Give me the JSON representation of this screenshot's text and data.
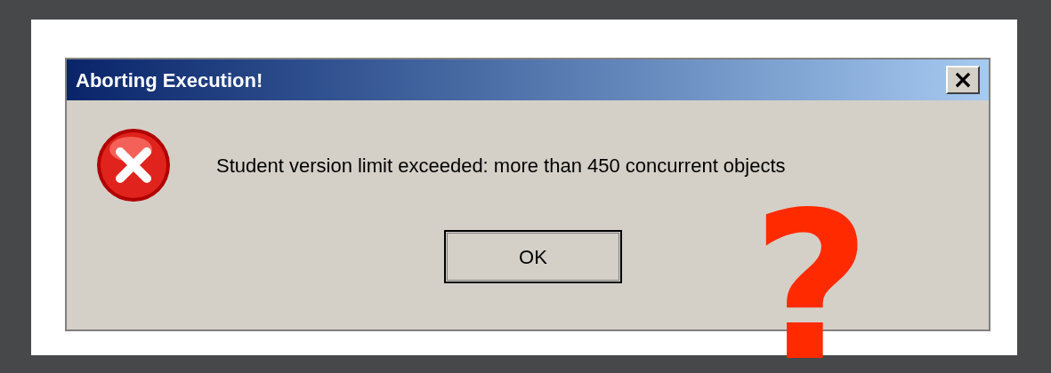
{
  "dialog": {
    "title": "Aborting Execution!",
    "close": "×",
    "message": "Student version limit exceeded: more than 450 concurrent objects",
    "buttons": [
      "OK"
    ]
  },
  "annotation": {
    "text": "?"
  }
}
